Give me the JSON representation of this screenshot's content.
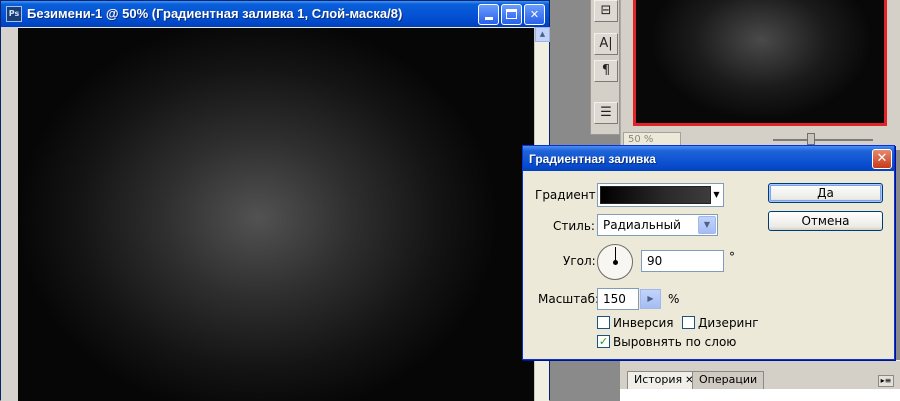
{
  "document_window": {
    "app_icon": "photoshop-doc-icon",
    "app_icon_text": "Ps",
    "title": "Безимени-1 @ 50% (Градиентная заливка 1, Слой-маска/8)",
    "minimize_label": "",
    "maximize_label": "",
    "close_label": "✕"
  },
  "toolbar_palette": {
    "icons": [
      "stamp-icon",
      "text-icon",
      "paragraph-icon",
      "layer-comps-icon"
    ],
    "glyphs": [
      "⊟",
      "A|",
      "¶",
      "☰"
    ]
  },
  "navigator": {
    "zoom_value": "50 %"
  },
  "dialog": {
    "title": "Градиентная заливка",
    "close_label": "✕",
    "gradient_label": "Градиент:",
    "style_label": "Стиль:",
    "style_value": "Радиальный",
    "angle_label": "Угол:",
    "angle_value": "90",
    "angle_unit": "°",
    "scale_label": "Масштаб:",
    "scale_value": "150",
    "scale_unit": "%",
    "reverse_label": "Инверсия",
    "reverse_checked": false,
    "dither_label": "Дизеринг",
    "dither_checked": false,
    "align_label": "Выровнять по слою",
    "align_checked": true,
    "ok_label": "Да",
    "cancel_label": "Отмена"
  },
  "history_panel": {
    "tabs": [
      {
        "label": "История",
        "active": true
      },
      {
        "label": "Операции",
        "active": false
      }
    ],
    "tab_close": "✕",
    "menu_glyph": "▸≡"
  },
  "colors": {
    "xp_title_blue": "#0553d6",
    "canvas_dark": "#141414",
    "navigator_border": "#e0242a",
    "dialog_face": "#ece9d8"
  }
}
